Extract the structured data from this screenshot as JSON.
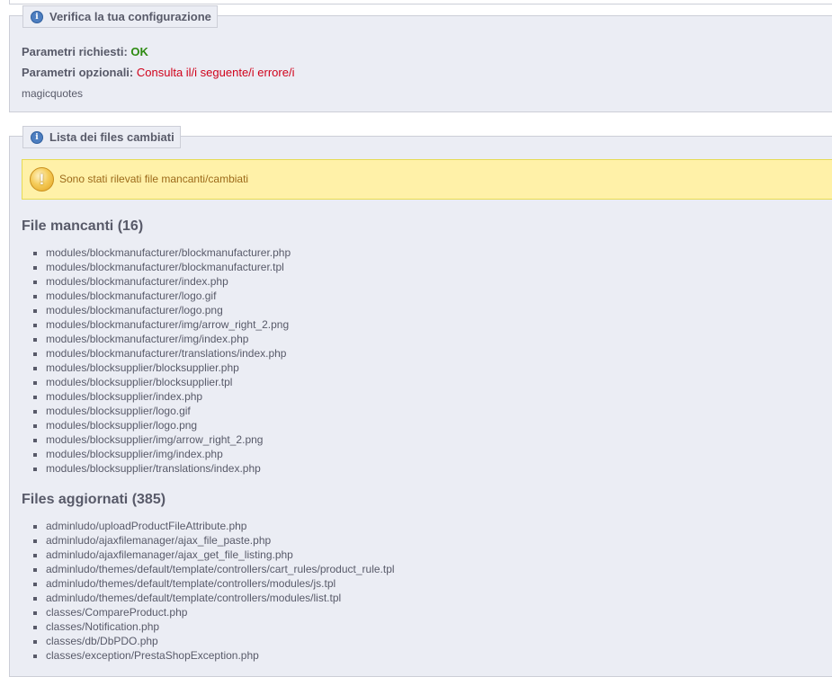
{
  "config": {
    "legend": "Verifica la tua configurazione",
    "required_label": "Parametri richiesti:",
    "required_value": "OK",
    "optional_label": "Parametri opzionali:",
    "optional_value": "Consulta il/i seguente/i errore/i",
    "optional_item": "magicquotes"
  },
  "files": {
    "legend": "Lista dei files cambiati",
    "warning": "Sono stati rilevati file mancanti/cambiati",
    "missing_title": "File mancanti (16)",
    "missing": [
      "modules/blockmanufacturer/blockmanufacturer.php",
      "modules/blockmanufacturer/blockmanufacturer.tpl",
      "modules/blockmanufacturer/index.php",
      "modules/blockmanufacturer/logo.gif",
      "modules/blockmanufacturer/logo.png",
      "modules/blockmanufacturer/img/arrow_right_2.png",
      "modules/blockmanufacturer/img/index.php",
      "modules/blockmanufacturer/translations/index.php",
      "modules/blocksupplier/blocksupplier.php",
      "modules/blocksupplier/blocksupplier.tpl",
      "modules/blocksupplier/index.php",
      "modules/blocksupplier/logo.gif",
      "modules/blocksupplier/logo.png",
      "modules/blocksupplier/img/arrow_right_2.png",
      "modules/blocksupplier/img/index.php",
      "modules/blocksupplier/translations/index.php"
    ],
    "updated_title": "Files aggiornati (385)",
    "updated": [
      "adminludo/uploadProductFileAttribute.php",
      "adminludo/ajaxfilemanager/ajax_file_paste.php",
      "adminludo/ajaxfilemanager/ajax_get_file_listing.php",
      "adminludo/themes/default/template/controllers/cart_rules/product_rule.tpl",
      "adminludo/themes/default/template/controllers/modules/js.tpl",
      "adminludo/themes/default/template/controllers/modules/list.tpl",
      "classes/CompareProduct.php",
      "classes/Notification.php",
      "classes/db/DbPDO.php",
      "classes/exception/PrestaShopException.php"
    ]
  },
  "colors": {
    "ok": "#2e8b12",
    "error": "#d0021b",
    "panel": "#ebedf4",
    "warning_bg": "#fff1a8"
  },
  "icons": {
    "legend_icon": "info-icon",
    "warning_icon": "warning-icon"
  }
}
